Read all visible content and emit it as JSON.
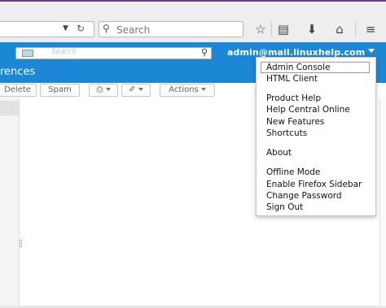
{
  "browser": {
    "url_dropdown_icon": "chevron-down-icon",
    "reload_icon": "reload-icon",
    "search_placeholder": "Search",
    "toolbar_icons": [
      "star-icon",
      "reading-list-icon",
      "download-icon",
      "home-icon",
      "menu-icon"
    ]
  },
  "app_header": {
    "search_placeholder": "Search",
    "user_account": "admin@mail.linuxhelp.com",
    "page_title": "rences",
    "background_color": "#1c87d4"
  },
  "toolbar": {
    "delete_label": "Delete",
    "spam_label": "Spam",
    "actions_label": "Actions"
  },
  "menu": {
    "items": [
      {
        "label": "Admin Console"
      },
      {
        "label": "HTML Client"
      },
      {
        "label": "Product Help"
      },
      {
        "label": "Help Central Online"
      },
      {
        "label": "New Features"
      },
      {
        "label": "Shortcuts"
      },
      {
        "label": "About"
      },
      {
        "label": "Offline Mode"
      },
      {
        "label": "Enable Firefox Sidebar"
      },
      {
        "label": "Change Password"
      },
      {
        "label": "Sign Out"
      }
    ]
  }
}
